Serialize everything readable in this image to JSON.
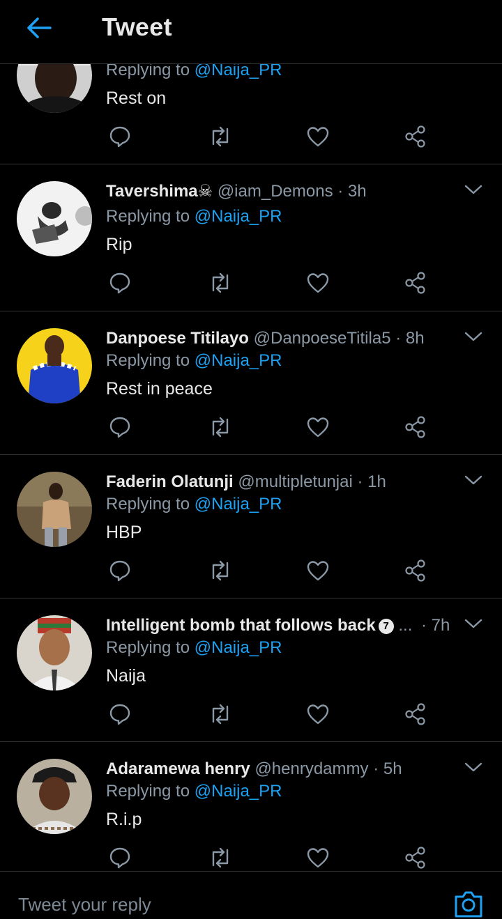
{
  "header": {
    "title": "Tweet"
  },
  "tweets": [
    {
      "name": "",
      "handle": "",
      "time": "",
      "replying_prefix": "Replying to",
      "mention": "@Naija_PR",
      "text": "Rest on"
    },
    {
      "name": "Tavershima",
      "name_emoji": "☠",
      "handle": "@iam_Demons",
      "time": "· 3h",
      "replying_prefix": "Replying to",
      "mention": "@Naija_PR",
      "text": "Rip"
    },
    {
      "name": "Danpoese Titilayo",
      "handle": "@DanpoeseTitila5",
      "time": "· 8h",
      "replying_prefix": "Replying to",
      "mention": "@Naija_PR",
      "text": "Rest in peace"
    },
    {
      "name": "Faderin Olatunji",
      "handle": "@multipletunjai",
      "time": "· 1h",
      "replying_prefix": "Replying to",
      "mention": "@Naija_PR",
      "text": "HBP"
    },
    {
      "name": "Intelligent bomb that follows back",
      "badge": "7",
      "handle": "...",
      "time": "· 7h",
      "replying_prefix": "Replying to",
      "mention": "@Naija_PR",
      "text": "Naija"
    },
    {
      "name": "Adaramewa henry",
      "handle": "@henrydammy",
      "time": "· 5h",
      "replying_prefix": "Replying to",
      "mention": "@Naija_PR",
      "text": "R.i.p"
    }
  ],
  "icons": {
    "back": "arrow-left-icon",
    "reply": "reply-icon",
    "retweet": "retweet-icon",
    "like": "heart-icon",
    "share": "share-icon",
    "more": "chevron-down-icon",
    "camera": "camera-icon"
  },
  "composer": {
    "placeholder": "Tweet your reply"
  },
  "colors": {
    "accent": "#1da1f2",
    "background": "#000000",
    "secondary_text": "#8b98a5",
    "divider": "#2f3336"
  }
}
